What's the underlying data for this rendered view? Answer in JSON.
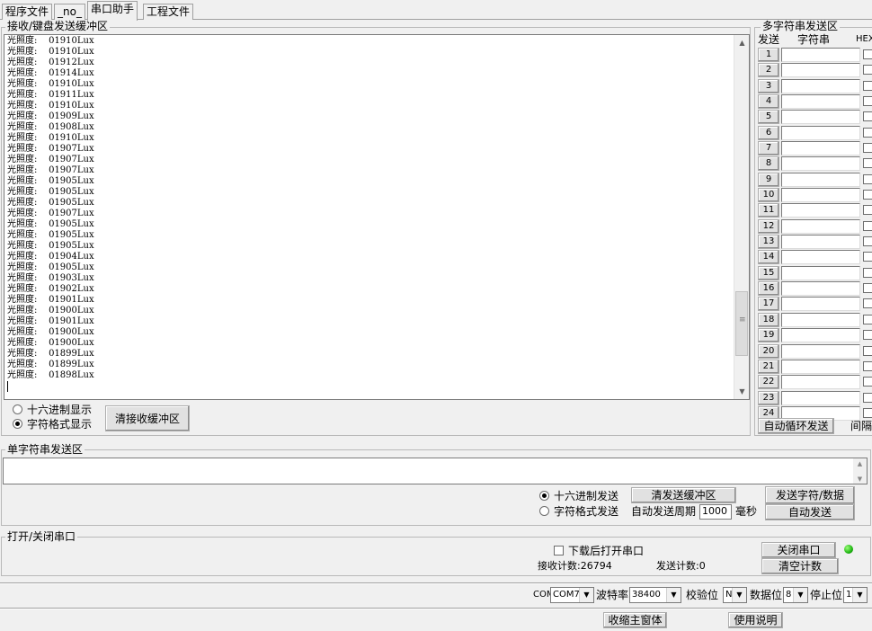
{
  "tabs": [
    "程序文件",
    "_no_",
    "串口助手",
    "工程文件"
  ],
  "receive": {
    "title": "接收/键盘发送缓冲区",
    "lines": [
      "光照度:    01910Lux",
      "光照度:    01910Lux",
      "光照度:    01912Lux",
      "光照度:    01914Lux",
      "光照度:    01910Lux",
      "光照度:    01911Lux",
      "光照度:    01910Lux",
      "光照度:    01909Lux",
      "光照度:    01908Lux",
      "光照度:    01910Lux",
      "光照度:    01907Lux",
      "光照度:    01907Lux",
      "光照度:    01907Lux",
      "光照度:    01905Lux",
      "光照度:    01905Lux",
      "光照度:    01905Lux",
      "光照度:    01907Lux",
      "光照度:    01905Lux",
      "光照度:    01905Lux",
      "光照度:    01905Lux",
      "光照度:    01904Lux",
      "光照度:    01905Lux",
      "光照度:    01903Lux",
      "光照度:    01902Lux",
      "光照度:    01901Lux",
      "光照度:    01900Lux",
      "光照度:    01901Lux",
      "光照度:    01900Lux",
      "光照度:    01900Lux",
      "光照度:    01899Lux",
      "光照度:    01899Lux",
      "光照度:    01898Lux"
    ],
    "hex_display": "十六进制显示",
    "char_display": "字符格式显示",
    "clear_button": "清接收缓冲区"
  },
  "multi": {
    "title": "多字符串发送区",
    "col_send": "发送",
    "col_string": "字符串",
    "col_hex": "HEX",
    "rows": [
      "1",
      "2",
      "3",
      "4",
      "5",
      "6",
      "7",
      "8",
      "9",
      "10",
      "11",
      "12",
      "13",
      "14",
      "15",
      "16",
      "17",
      "18",
      "19",
      "20",
      "21",
      "22",
      "23",
      "24"
    ],
    "auto_loop": "自动循环发送",
    "interval": "间隔"
  },
  "single": {
    "title": "单字符串发送区",
    "hex_send": "十六进制发送",
    "char_send": "字符格式发送",
    "clear_send": "清发送缓冲区",
    "auto_period_label": "自动发送周期",
    "period_value": "1000",
    "ms": "毫秒",
    "send_button": "发送字符/数据",
    "auto_send_button": "自动发送"
  },
  "port": {
    "title": "打开/关闭串口",
    "open_after_download": "下载后打开串口",
    "recv_count": "接收计数:26794",
    "send_count": "发送计数:0",
    "close_button": "关闭串口",
    "clear_count": "清空计数"
  },
  "settings": {
    "com_label": "COM",
    "com_value": "COM7",
    "baud_label": "波特率",
    "baud_value": "38400",
    "parity_label": "校验位",
    "parity_value": "N",
    "databits_label": "数据位",
    "databits_value": "8",
    "stopbits_label": "停止位",
    "stopbits_value": "1"
  },
  "bottom": {
    "collapse": "收缩主窗体",
    "help": "使用说明"
  },
  "colors": {
    "led": "#1fb512"
  }
}
